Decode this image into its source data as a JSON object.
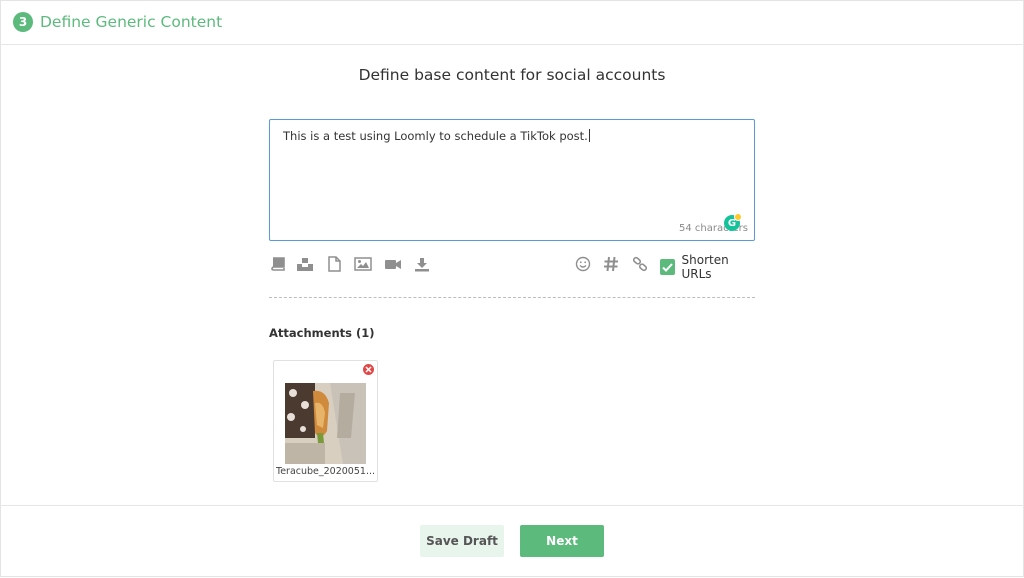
{
  "header": {
    "step_number": "3",
    "title": "Define Generic Content"
  },
  "main": {
    "section_title": "Define base content for social accounts",
    "composer": {
      "text": "This is a test using Loomly to schedule a TikTok post.",
      "char_count": "54 characters"
    },
    "toolbar": {
      "left_icons": [
        "library-icon",
        "inbox-icon",
        "document-icon",
        "image-icon",
        "video-icon",
        "download-icon"
      ],
      "right_icons": [
        "emoji-icon",
        "hashtag-icon",
        "link-icon"
      ],
      "shorten_urls_label": "Shorten URLs",
      "shorten_urls_checked": true
    },
    "attachments": {
      "label": "Attachments (1)",
      "items": [
        {
          "file_name": "Teracube_2020051..."
        }
      ]
    }
  },
  "footer": {
    "save_draft_label": "Save Draft",
    "next_label": "Next"
  },
  "colors": {
    "accent_green": "#5cba7d",
    "focus_blue": "#5b9bd5",
    "remove_red": "#e04848"
  }
}
